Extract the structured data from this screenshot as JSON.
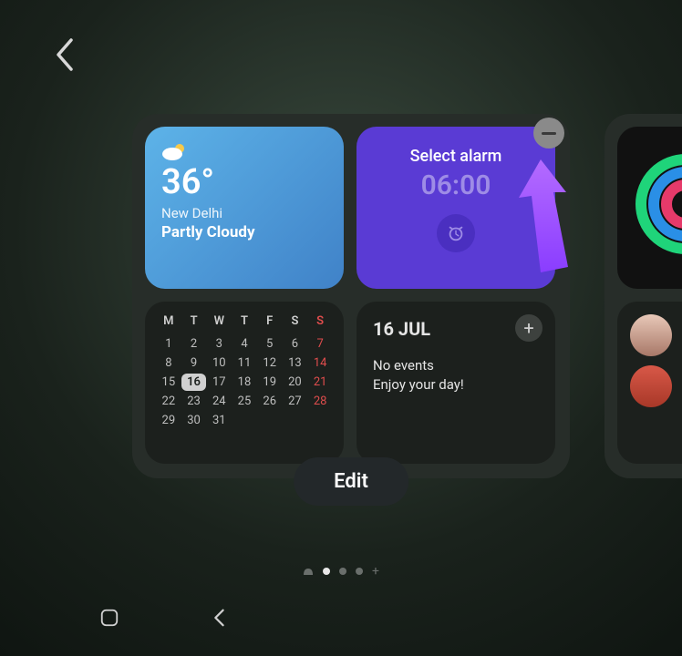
{
  "weather": {
    "temperature": "36°",
    "city": "New Delhi",
    "condition": "Partly Cloudy"
  },
  "alarm": {
    "title": "Select alarm",
    "time": "06:00"
  },
  "calendar": {
    "headers": [
      "M",
      "T",
      "W",
      "T",
      "F",
      "S",
      "S"
    ],
    "weeks": [
      [
        "",
        "",
        "",
        "",
        "",
        "",
        ""
      ],
      [
        1,
        2,
        3,
        4,
        5,
        6,
        7
      ],
      [
        8,
        9,
        10,
        11,
        12,
        13,
        14
      ],
      [
        15,
        16,
        17,
        18,
        19,
        20,
        21
      ],
      [
        22,
        23,
        24,
        25,
        26,
        27,
        28
      ],
      [
        29,
        30,
        31,
        "",
        "",
        "",
        ""
      ]
    ],
    "today": 16
  },
  "events": {
    "date": "16 JUL",
    "line1": "No events",
    "line2": "Enjoy your day!"
  },
  "edit_label": "Edit",
  "page_indicator": {
    "total": 4,
    "active_index": 1,
    "has_add": true
  }
}
